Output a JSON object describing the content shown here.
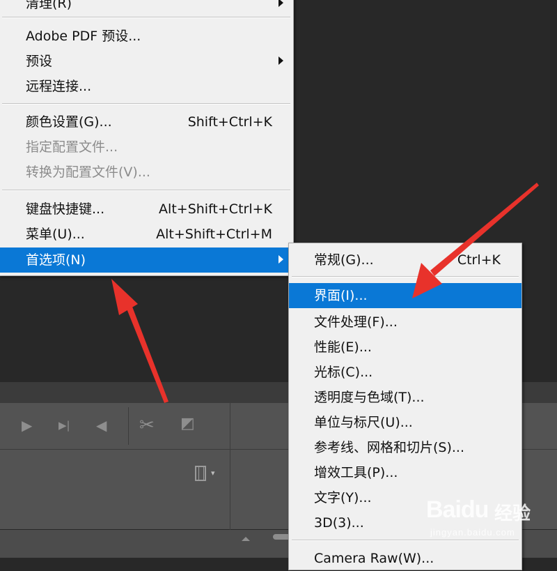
{
  "main_menu": {
    "items": [
      {
        "label": "清理(R)",
        "shortcut": "",
        "disabled": false,
        "submenu": true
      },
      {
        "label": "Adobe PDF 预设...",
        "shortcut": "",
        "disabled": false,
        "submenu": false
      },
      {
        "label": "预设",
        "shortcut": "",
        "disabled": false,
        "submenu": true
      },
      {
        "label": "远程连接...",
        "shortcut": "",
        "disabled": false,
        "submenu": false
      },
      {
        "label": "颜色设置(G)...",
        "shortcut": "Shift+Ctrl+K",
        "disabled": false,
        "submenu": false
      },
      {
        "label": "指定配置文件...",
        "shortcut": "",
        "disabled": true,
        "submenu": false
      },
      {
        "label": "转换为配置文件(V)...",
        "shortcut": "",
        "disabled": true,
        "submenu": false
      },
      {
        "label": "键盘快捷键...",
        "shortcut": "Alt+Shift+Ctrl+K",
        "disabled": false,
        "submenu": false
      },
      {
        "label": "菜单(U)...",
        "shortcut": "Alt+Shift+Ctrl+M",
        "disabled": false,
        "submenu": false
      },
      {
        "label": "首选项(N)",
        "shortcut": "",
        "disabled": false,
        "submenu": true,
        "highlighted": true
      }
    ]
  },
  "preferences_submenu": {
    "items": [
      {
        "label": "常规(G)...",
        "shortcut": "Ctrl+K"
      },
      {
        "label": "界面(I)...",
        "shortcut": "",
        "highlighted": true
      },
      {
        "label": "文件处理(F)...",
        "shortcut": ""
      },
      {
        "label": "性能(E)...",
        "shortcut": ""
      },
      {
        "label": "光标(C)...",
        "shortcut": ""
      },
      {
        "label": "透明度与色域(T)...",
        "shortcut": ""
      },
      {
        "label": "单位与标尺(U)...",
        "shortcut": ""
      },
      {
        "label": "参考线、网格和切片(S)...",
        "shortcut": ""
      },
      {
        "label": "增效工具(P)...",
        "shortcut": ""
      },
      {
        "label": "文字(Y)...",
        "shortcut": ""
      },
      {
        "label": "3D(3)...",
        "shortcut": ""
      },
      {
        "label": "Camera Raw(W)...",
        "shortcut": ""
      }
    ]
  },
  "timeline_toolbar": {
    "icons": [
      "play-icon",
      "next-frame-icon",
      "audio-icon",
      "scissors-icon",
      "transition-icon",
      "film-icon"
    ],
    "glyphs": {
      "play": "▶",
      "next": "▶|",
      "audio": "◀",
      "scissors": "✂",
      "transition": "◩"
    }
  },
  "annotations": {
    "arrow_color": "#e8322b"
  },
  "watermark": {
    "brand": "Baidu",
    "cn": "经验",
    "url": "jingyan.baidu.com"
  },
  "colors": {
    "highlight": "#0a78d6",
    "menu_bg": "#f0f0f0",
    "app_bg": "#282828",
    "panel": "#535353"
  }
}
